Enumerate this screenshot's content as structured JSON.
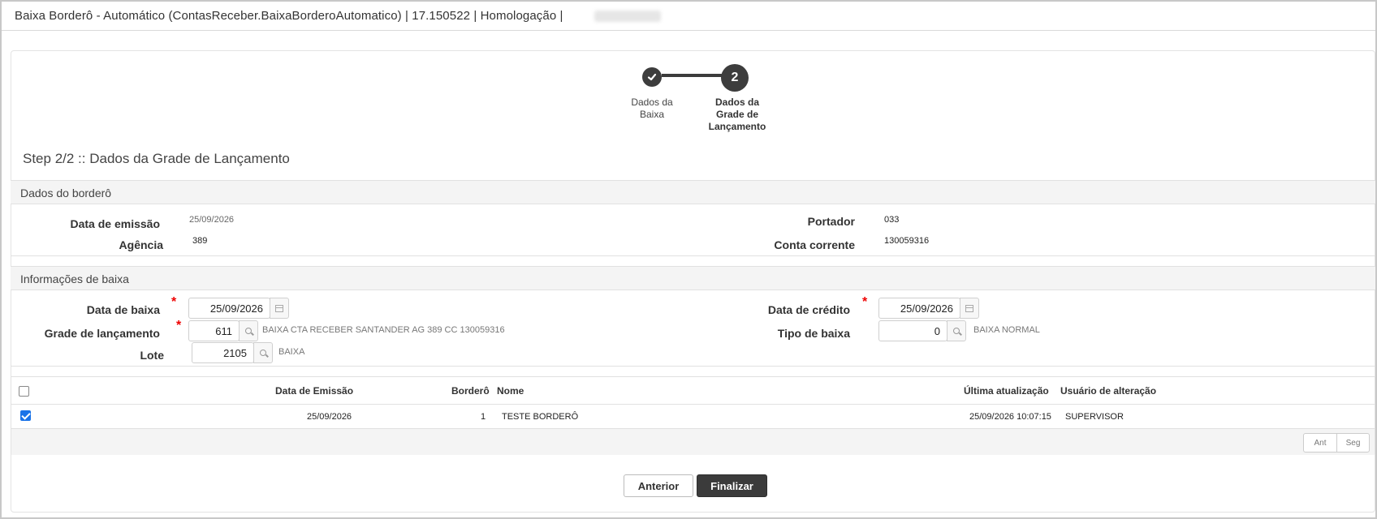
{
  "window": {
    "title": "Baixa Borderô - Automático (ContasReceber.BaixaBorderoAutomatico) | 17.150522 | Homologação |"
  },
  "stepper": {
    "steps": [
      {
        "label": "Dados da Baixa",
        "status": "done"
      },
      {
        "number": "2",
        "label": "Dados da Grade de Lançamento",
        "status": "current"
      }
    ]
  },
  "step_title": "Step 2/2 :: Dados da Grade de Lançamento",
  "bordero": {
    "section_title": "Dados do borderô",
    "data_emissao_label": "Data de emissão",
    "data_emissao": "25/09/2026",
    "agencia_label": "Agência",
    "agencia": "389",
    "portador_label": "Portador",
    "portador": "033",
    "conta_label": "Conta corrente",
    "conta": "130059316"
  },
  "baixa": {
    "section_title": "Informações de baixa",
    "data_baixa_label": "Data de baixa",
    "data_baixa": "25/09/2026",
    "grade_label": "Grade de lançamento",
    "grade": "611",
    "grade_desc": "BAIXA CTA RECEBER SANTANDER AG 389 CC 130059316",
    "lote_label": "Lote",
    "lote": "2105",
    "lote_desc": "BAIXA",
    "data_credito_label": "Data de crédito",
    "data_credito": "25/09/2026",
    "tipo_label": "Tipo de baixa",
    "tipo": "0",
    "tipo_desc": "BAIXA NORMAL"
  },
  "table": {
    "columns": [
      "Data de Emissão",
      "Borderô",
      "Nome",
      "Última atualização",
      "Usuário de alteração"
    ],
    "rows": [
      {
        "checked": true,
        "data_emissao": "25/09/2026",
        "bordero": "1",
        "nome": "TESTE BORDERÔ",
        "ultima_atualizacao": "25/09/2026 10:07:15",
        "usuario": "SUPERVISOR"
      }
    ],
    "pager_prev": "Ant",
    "pager_next": "Seg"
  },
  "buttons": {
    "anterior": "Anterior",
    "finalizar": "Finalizar"
  },
  "colors": {
    "accent_dark": "#3b3b3b",
    "required": "#ee0000",
    "checkbox": "#1a73e8"
  }
}
